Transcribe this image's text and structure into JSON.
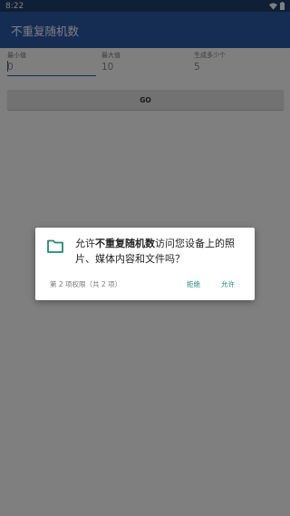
{
  "status_bar": {
    "time": "8:22"
  },
  "app_bar": {
    "title": "不重复随机数"
  },
  "form": {
    "min_label": "最小值",
    "min_value": "0",
    "max_label": "最大值",
    "max_value": "10",
    "count_label": "生成多少个",
    "count_value": "5",
    "go_label": "GO"
  },
  "permission_dialog": {
    "prefix": "允许",
    "app_name": "不重复随机数",
    "suffix": "访问您设备上的照片、媒体内容和文件吗？",
    "counter": "第 2 项权限（共 2 项）",
    "deny_label": "拒绝",
    "allow_label": "允许",
    "icon": "folder-icon",
    "accent_color": "#1f8a70"
  },
  "colors": {
    "status_bar": "#1d3f6c",
    "app_bar": "#2b5aa6",
    "scrim_opacity": 0.5
  }
}
